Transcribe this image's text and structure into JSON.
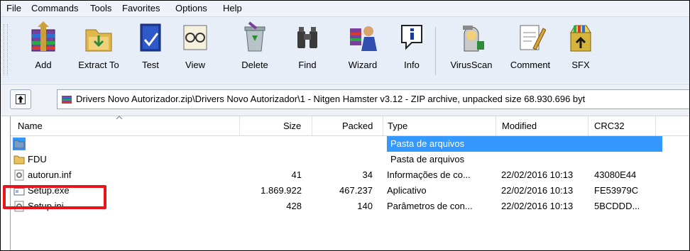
{
  "menu": [
    "File",
    "Commands",
    "Tools",
    "Favorites",
    "Options",
    "Help"
  ],
  "toolbar": {
    "add": "Add",
    "extract_to": "Extract To",
    "test": "Test",
    "view": "View",
    "delete": "Delete",
    "find": "Find",
    "wizard": "Wizard",
    "info": "Info",
    "virusscan": "VirusScan",
    "comment": "Comment",
    "sfx": "SFX"
  },
  "address": {
    "path": "Drivers Novo Autorizador.zip\\Drivers Novo Autorizador\\1 - Nitgen Hamster v3.12 - ZIP archive, unpacked size 68.930.696 byt"
  },
  "columns": {
    "name": "Name",
    "size": "Size",
    "packed": "Packed",
    "type": "Type",
    "modified": "Modified",
    "crc32": "CRC32"
  },
  "rows": [
    {
      "name": "..",
      "size": "",
      "packed": "",
      "type": "Pasta de arquivos",
      "modified": "",
      "crc": "",
      "icon": "folder-icon"
    },
    {
      "name": "FDU",
      "size": "",
      "packed": "",
      "type": "Pasta de arquivos",
      "modified": "",
      "crc": "",
      "icon": "folder-icon"
    },
    {
      "name": "autorun.inf",
      "size": "41",
      "packed": "34",
      "type": "Informações de co...",
      "modified": "22/02/2016 10:13",
      "crc": "43080E44",
      "icon": "settings-file-icon"
    },
    {
      "name": "Setup.exe",
      "size": "1.869.922",
      "packed": "467.237",
      "type": "Aplicativo",
      "modified": "22/02/2016 10:13",
      "crc": "FE53979C",
      "icon": "application-icon"
    },
    {
      "name": "Setup.ini",
      "size": "428",
      "packed": "140",
      "type": "Parâmetros de con...",
      "modified": "22/02/2016 10:13",
      "crc": "5BCDDD...",
      "icon": "settings-file-icon"
    }
  ],
  "colors": {
    "selection": "#3399ff",
    "highlight": "#e8141b",
    "toolbar_bg": "#e7eef8"
  }
}
